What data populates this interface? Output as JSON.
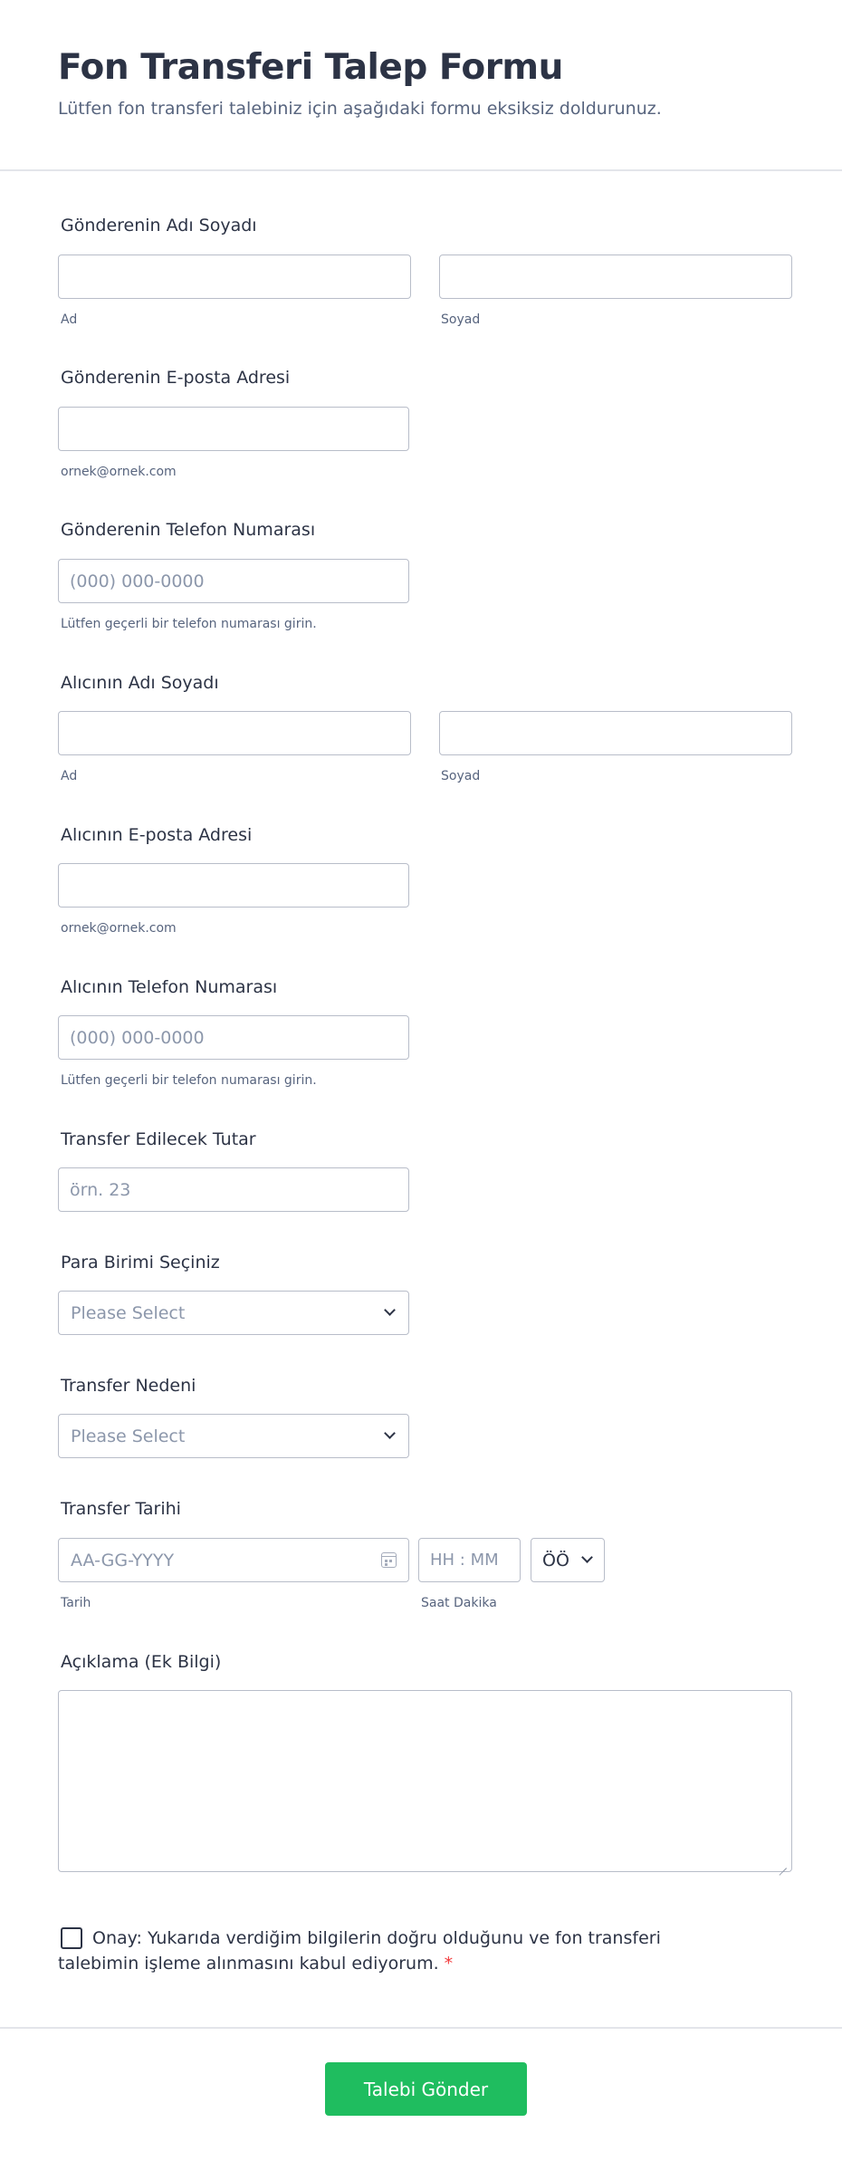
{
  "header": {
    "title": "Fon Transferi Talep Formu",
    "subtitle": "Lütfen fon transferi talebiniz için aşağıdaki formu eksiksiz doldurunuz."
  },
  "sender_name": {
    "label": "Gönderenin Adı Soyadı",
    "first_sub": "Ad",
    "last_sub": "Soyad",
    "first_value": "",
    "last_value": ""
  },
  "sender_email": {
    "label": "Gönderenin E-posta Adresi",
    "sub": "ornek@ornek.com",
    "value": ""
  },
  "sender_phone": {
    "label": "Gönderenin Telefon Numarası",
    "placeholder": "(000) 000-0000",
    "sub": "Lütfen geçerli bir telefon numarası girin."
  },
  "recipient_name": {
    "label": "Alıcının Adı Soyadı",
    "first_sub": "Ad",
    "last_sub": "Soyad",
    "first_value": "",
    "last_value": ""
  },
  "recipient_email": {
    "label": "Alıcının E-posta Adresi",
    "sub": "ornek@ornek.com",
    "value": ""
  },
  "recipient_phone": {
    "label": "Alıcının Telefon Numarası",
    "placeholder": "(000) 000-0000",
    "sub": "Lütfen geçerli bir telefon numarası girin."
  },
  "amount": {
    "label": "Transfer Edilecek Tutar",
    "placeholder": "örn. 23"
  },
  "currency": {
    "label": "Para Birimi Seçiniz",
    "selected": "Please Select"
  },
  "reason": {
    "label": "Transfer Nedeni",
    "selected": "Please Select"
  },
  "transfer_date": {
    "label": "Transfer Tarihi",
    "date_placeholder": "AA-GG-YYYY",
    "time_placeholder": "HH : MM",
    "ampm_value": "ÖÖ",
    "date_sub": "Tarih",
    "time_sub": "Saat Dakika",
    "icon": "calendar-icon"
  },
  "notes": {
    "label": "Açıklama (Ek Bilgi)",
    "value": ""
  },
  "consent": {
    "text": "Onay: Yukarıda verdiğim bilgilerin doğru olduğunu ve fon transferi talebimin işleme alınmasını kabul ediyorum.",
    "required_mark": "*",
    "checked": false
  },
  "submit": {
    "label": "Talebi Gönder",
    "color": "#1fbd5f"
  },
  "colors": {
    "text": "#2c3345",
    "muted": "#57647e",
    "placeholder": "#8c97ab",
    "border": "#b8bdc9",
    "required": "#f23a3c"
  }
}
